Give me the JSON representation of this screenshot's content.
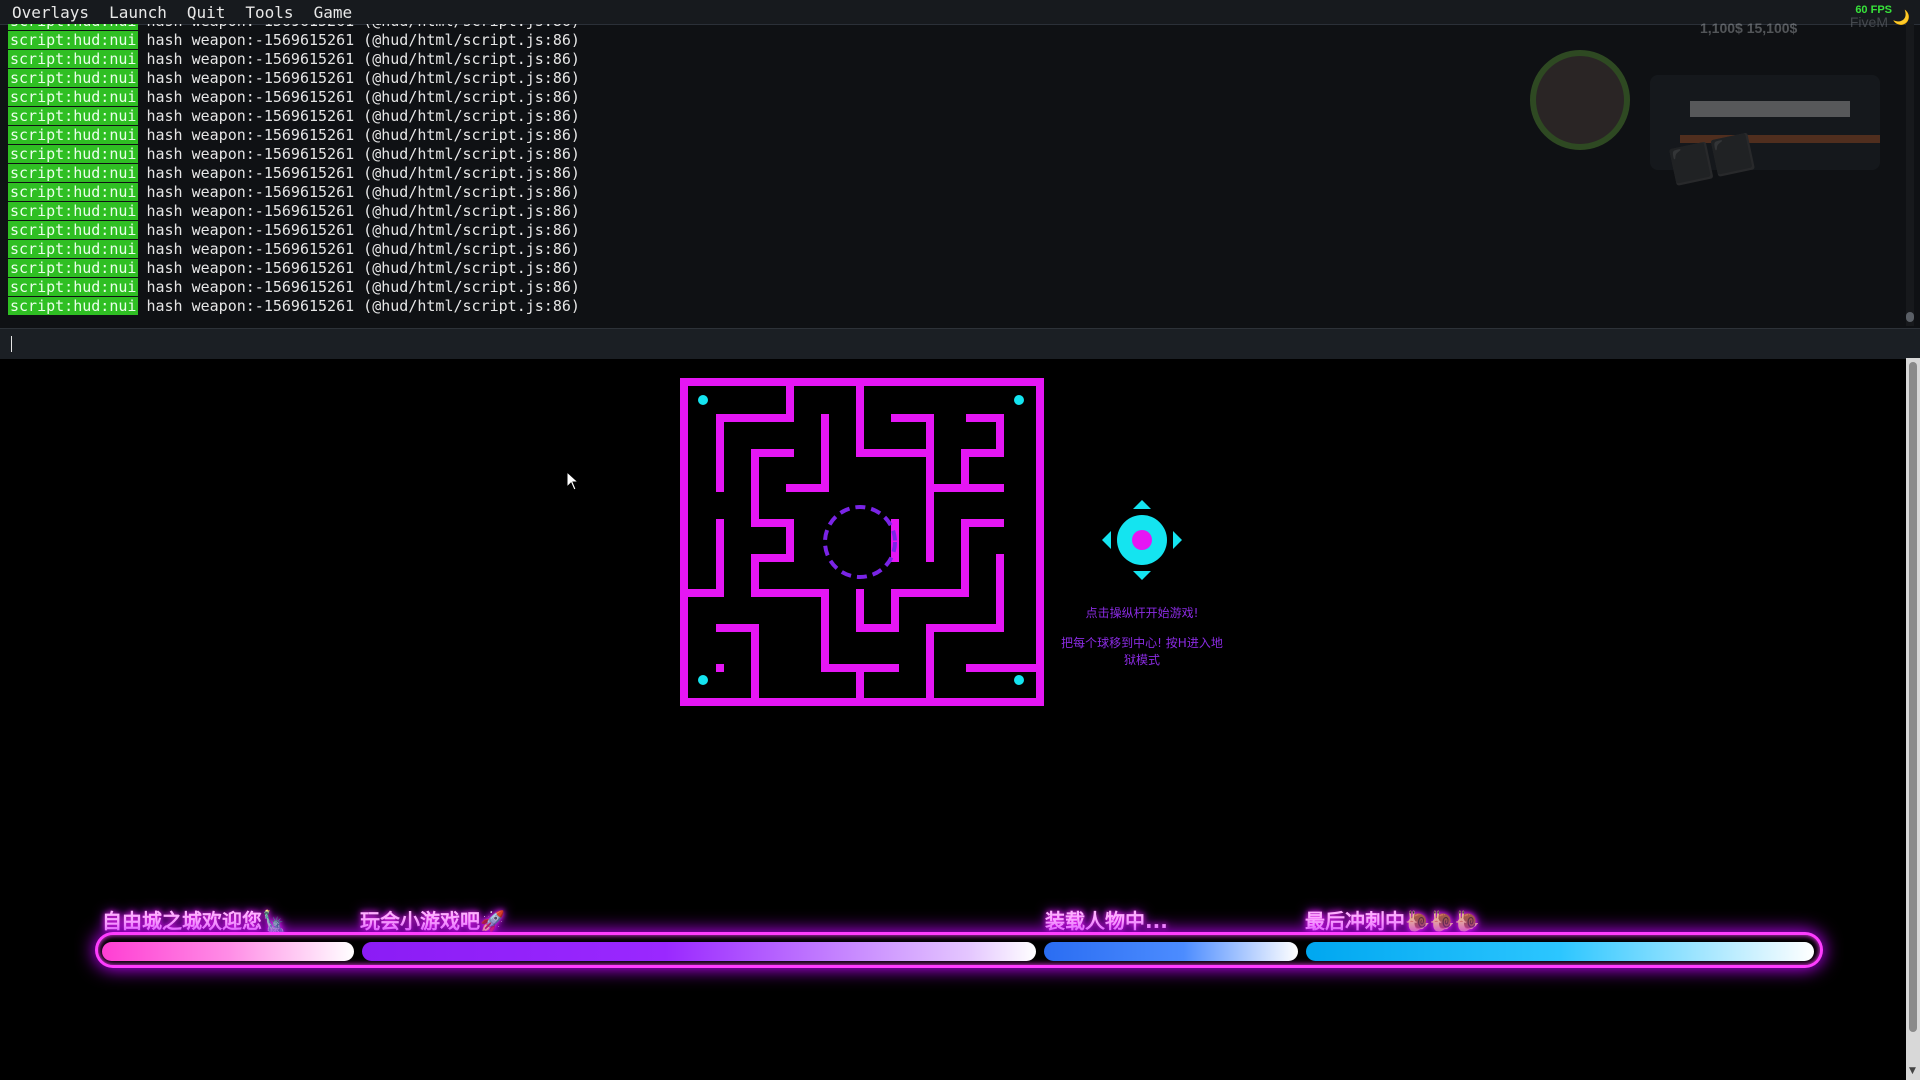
{
  "menu": {
    "items": [
      {
        "label": "Overlays"
      },
      {
        "label": "Launch"
      },
      {
        "label": "Quit"
      },
      {
        "label": "Tools"
      },
      {
        "label": "Game"
      }
    ]
  },
  "status": {
    "fps": "60 FPS",
    "brand": "FiveM"
  },
  "console": {
    "tag": "script:hud:nui",
    "message": "hash weapon:-1569615261 (@hud/html/script.js:86)",
    "input_value": ""
  },
  "hud_overlay": {
    "stats": "1,100$  15,100$"
  },
  "minigame": {
    "hint_start": "点击操纵杆开始游戏!",
    "hint_goal": "把每个球移到中心! 按H进入地狱模式"
  },
  "loading": {
    "stages": [
      {
        "label": "自由城之城欢迎您🗽"
      },
      {
        "label": "玩会小游戏吧🚀"
      },
      {
        "label": "装载人物中..."
      },
      {
        "label": "最后冲刺中🐌🐌🐌"
      }
    ]
  },
  "colors": {
    "maze_wall": "#e516f4",
    "ball": "#14e4f0",
    "center_ring": "#7a24e6",
    "console_tag": "#2fbf23"
  }
}
